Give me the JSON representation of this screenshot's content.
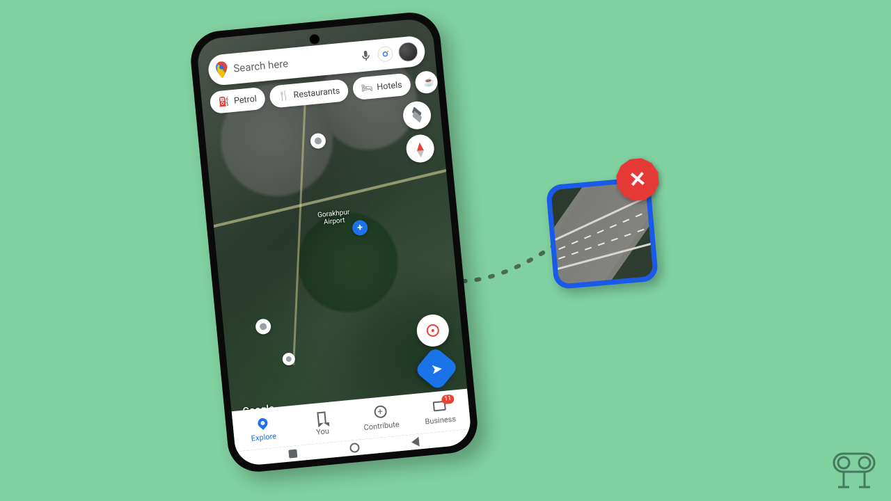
{
  "search": {
    "placeholder": "Search here"
  },
  "chips": [
    {
      "icon": "⛽",
      "label": "Petrol"
    },
    {
      "icon": "🍴",
      "label": "Restaurants"
    },
    {
      "icon": "🛏",
      "label": "Hotels"
    }
  ],
  "map": {
    "poi_label_line1": "Gorakhpur",
    "poi_label_line2": "Airport",
    "watermark": "Google"
  },
  "bottom_nav": {
    "items": [
      {
        "label": "Explore"
      },
      {
        "label": "You"
      },
      {
        "label": "Contribute"
      },
      {
        "label": "Business"
      }
    ],
    "badge": "11"
  }
}
